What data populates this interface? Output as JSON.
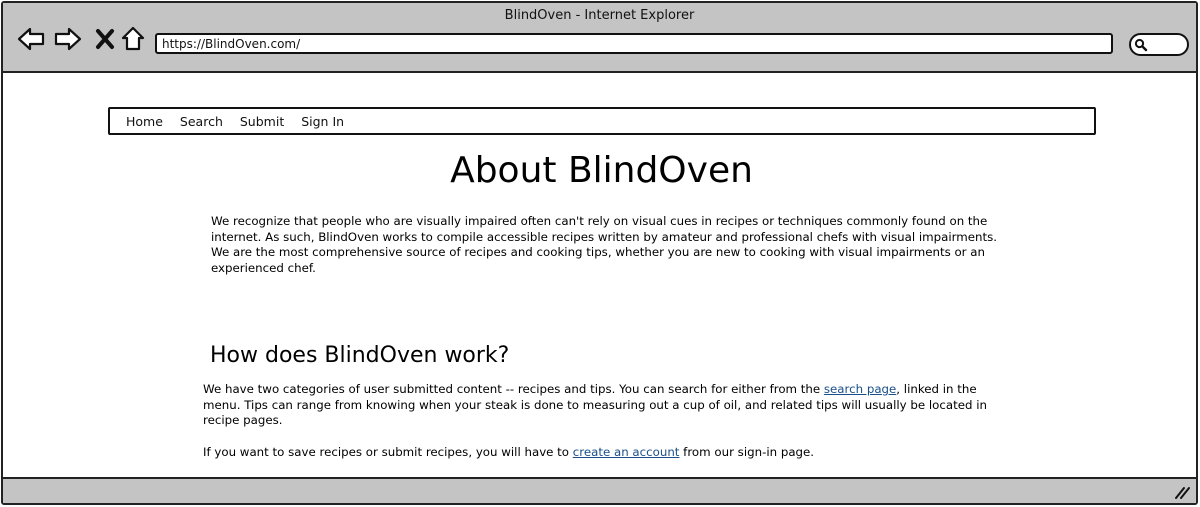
{
  "window": {
    "title": "BlindOven - Internet Explorer"
  },
  "toolbar": {
    "back_icon": "back-arrow-icon",
    "forward_icon": "forward-arrow-icon",
    "stop_icon": "close-icon",
    "home_icon": "home-icon",
    "search_icon": "search-icon"
  },
  "address_bar": {
    "url": "https://BlindOven.com/"
  },
  "nav": {
    "items": [
      {
        "label": "Home"
      },
      {
        "label": "Search"
      },
      {
        "label": "Submit"
      },
      {
        "label": "Sign In"
      }
    ]
  },
  "main": {
    "title": "About BlindOven",
    "intro": "We recognize that people who are visually impaired often can't rely on visual cues in recipes or techniques commonly found on the internet. As such, BlindOven works to compile accessible recipes written by amateur and professional chefs with visual impairments. We are the most comprehensive source of recipes and cooking tips, whether you are new to cooking with visual impairments or an experienced chef.",
    "section_heading": "How does BlindOven work?",
    "para1_before": "We have two categories of user submitted content -- recipes and tips. You can search for either from the ",
    "para1_link": "search page",
    "para1_after": ", linked in the menu. Tips can range from knowing when your steak is done to measuring out a cup of oil, and related tips will usually be located in recipe pages.",
    "para2_before": "If you want to save recipes or submit recipes, you will have to ",
    "para2_link": "create an account",
    "para2_after": " from our sign-in page."
  }
}
